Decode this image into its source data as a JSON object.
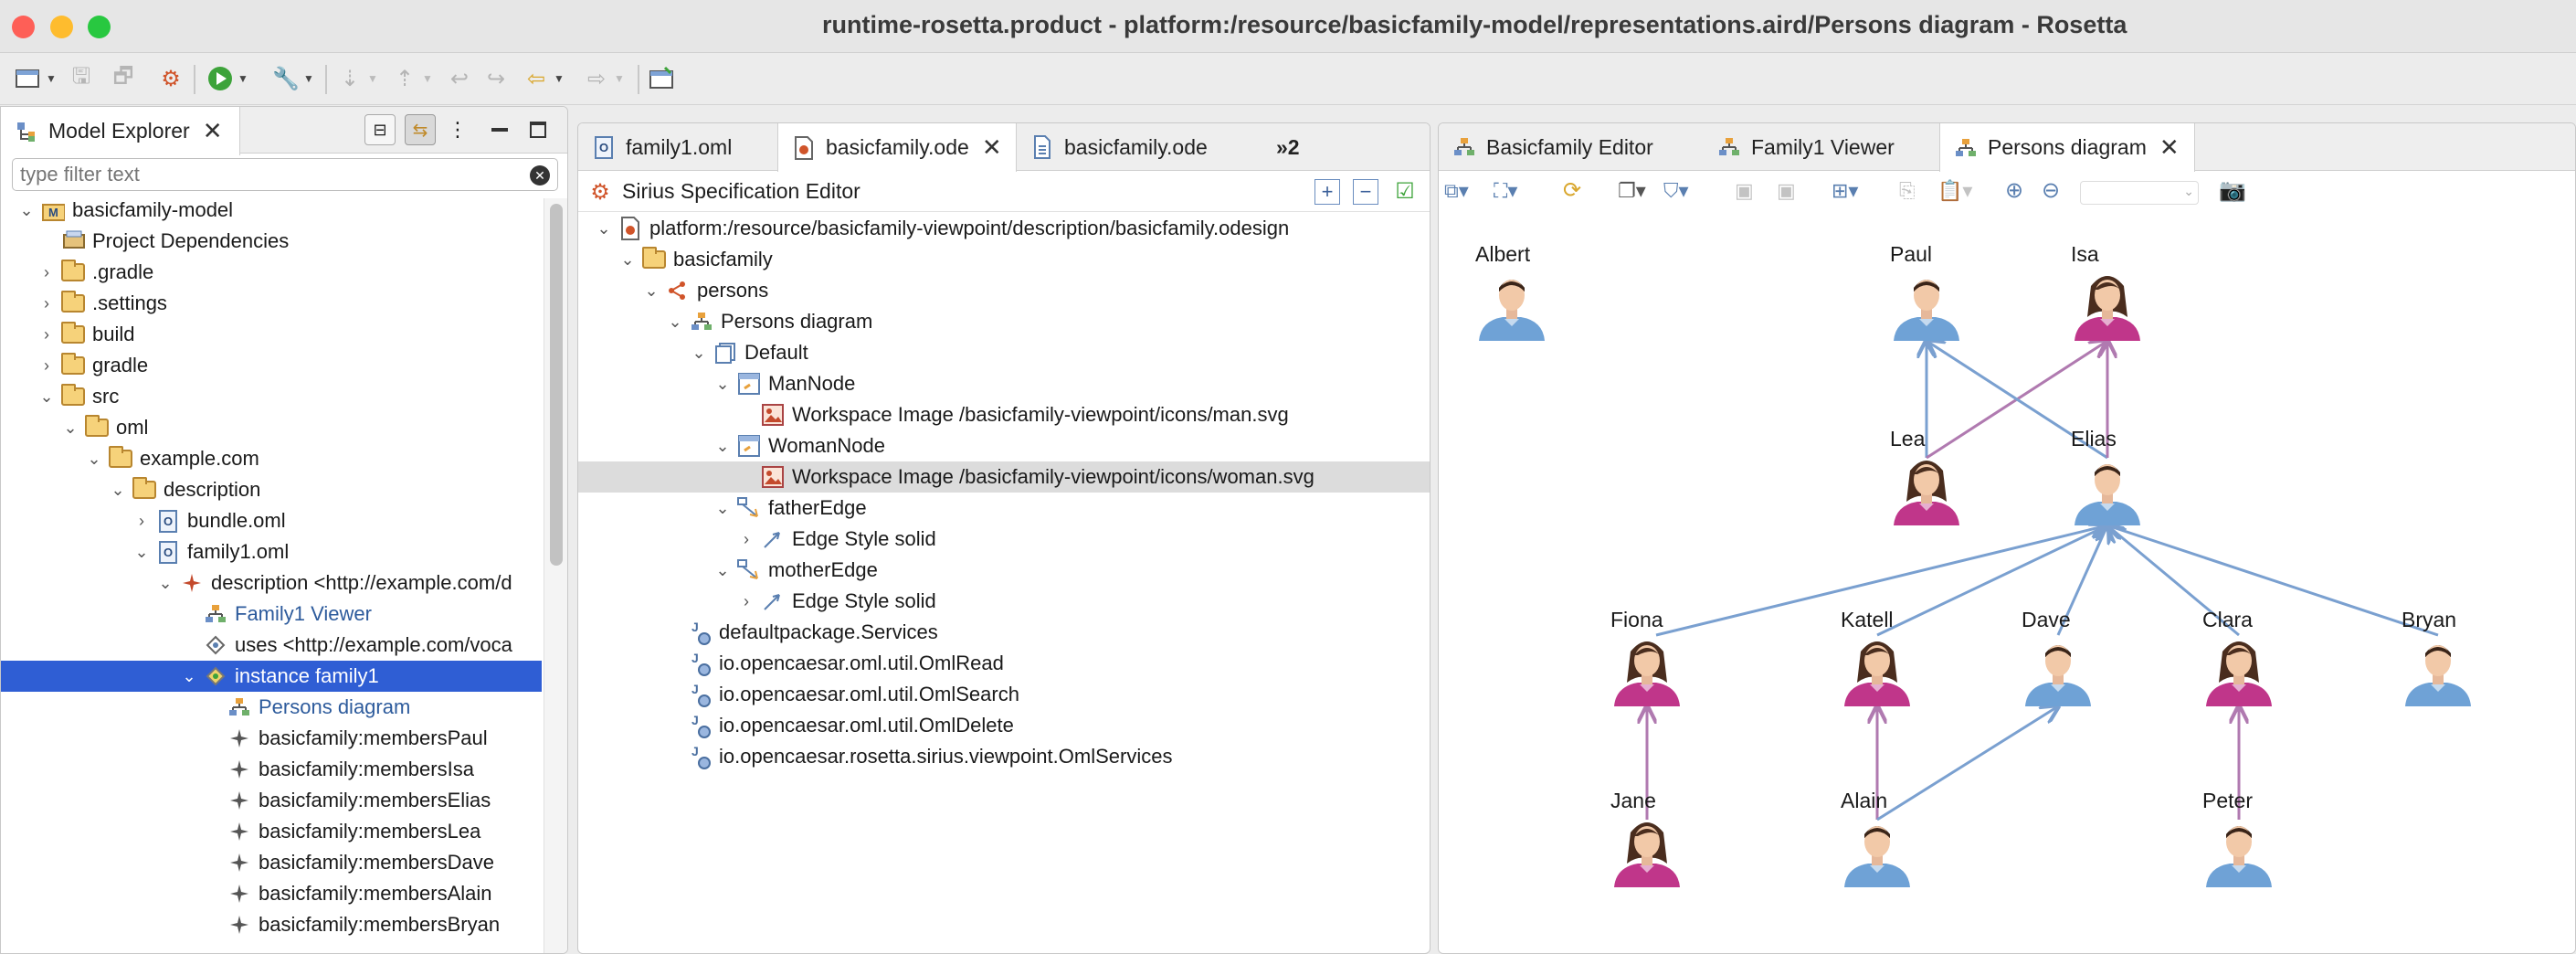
{
  "window": {
    "title": "runtime-rosetta.product - platform:/resource/basicfamily-model/representations.aird/Persons diagram - Rosetta"
  },
  "colors": {
    "selection": "#2f5ed4",
    "father_edge": "#7aa0d0",
    "mother_edge": "#b07ab0",
    "man_shirt": "#6fa2d6",
    "woman_shirt": "#c0368a"
  },
  "model_explorer": {
    "tab_label": "Model Explorer",
    "filter_placeholder": "type filter text",
    "tree": [
      {
        "label": "basicfamily-model",
        "icon": "project-icon",
        "expanded": true
      },
      {
        "label": "Project Dependencies",
        "icon": "library-icon"
      },
      {
        "label": ".gradle",
        "icon": "folder-icon"
      },
      {
        "label": ".settings",
        "icon": "folder-icon"
      },
      {
        "label": "build",
        "icon": "folder-icon"
      },
      {
        "label": "gradle",
        "icon": "folder-icon"
      },
      {
        "label": "src",
        "icon": "folder-icon",
        "expanded": true
      },
      {
        "label": "oml",
        "icon": "folder-icon",
        "expanded": true
      },
      {
        "label": "example.com",
        "icon": "folder-icon",
        "expanded": true
      },
      {
        "label": "description",
        "icon": "folder-icon",
        "expanded": true
      },
      {
        "label": "bundle.oml",
        "icon": "oml-file-icon"
      },
      {
        "label": "family1.oml",
        "icon": "oml-file-icon",
        "expanded": true
      },
      {
        "label": "description <http://example.com/d",
        "icon": "description-icon",
        "expanded": true
      },
      {
        "label": "Family1 Viewer",
        "icon": "diagram-icon",
        "link": true
      },
      {
        "label": "uses <http://example.com/voca",
        "icon": "uses-icon"
      },
      {
        "label": "instance family1",
        "icon": "instance-icon",
        "expanded": true,
        "selected": true
      },
      {
        "label": "Persons diagram",
        "icon": "diagram-icon",
        "link": true
      },
      {
        "label": "basicfamily:membersPaul",
        "icon": "member-icon"
      },
      {
        "label": "basicfamily:membersIsa",
        "icon": "member-icon"
      },
      {
        "label": "basicfamily:membersElias",
        "icon": "member-icon"
      },
      {
        "label": "basicfamily:membersLea",
        "icon": "member-icon"
      },
      {
        "label": "basicfamily:membersDave",
        "icon": "member-icon"
      },
      {
        "label": "basicfamily:membersAlain",
        "icon": "member-icon"
      },
      {
        "label": "basicfamily:membersBryan",
        "icon": "member-icon"
      }
    ]
  },
  "editor": {
    "tabs": [
      {
        "label": "family1.oml",
        "icon": "oml-file-icon"
      },
      {
        "label": "basicfamily.ode",
        "icon": "odesign-icon",
        "active": true,
        "closable": true
      },
      {
        "label": "basicfamily.ode",
        "icon": "file-icon"
      },
      {
        "label": "»2",
        "icon": ""
      }
    ],
    "header": "Sirius Specification Editor",
    "tree": [
      {
        "label": "platform:/resource/basicfamily-viewpoint/description/basicfamily.odesign",
        "icon": "odesign-icon"
      },
      {
        "label": "basicfamily",
        "icon": "folder-icon"
      },
      {
        "label": "persons",
        "icon": "viewpoint-icon"
      },
      {
        "label": "Persons diagram",
        "icon": "diagram-icon"
      },
      {
        "label": "Default",
        "icon": "layer-icon"
      },
      {
        "label": "ManNode",
        "icon": "node-icon"
      },
      {
        "label": "Workspace Image /basicfamily-viewpoint/icons/man.svg",
        "icon": "image-icon"
      },
      {
        "label": "WomanNode",
        "icon": "node-icon"
      },
      {
        "label": "Workspace Image /basicfamily-viewpoint/icons/woman.svg",
        "icon": "image-icon",
        "highlighted": true
      },
      {
        "label": "fatherEdge",
        "icon": "edge-icon"
      },
      {
        "label": "Edge Style solid",
        "icon": "edge-style-icon"
      },
      {
        "label": "motherEdge",
        "icon": "edge-icon"
      },
      {
        "label": "Edge Style solid",
        "icon": "edge-style-icon"
      },
      {
        "label": "defaultpackage.Services",
        "icon": "java-icon"
      },
      {
        "label": "io.opencaesar.oml.util.OmlRead",
        "icon": "java-icon"
      },
      {
        "label": "io.opencaesar.oml.util.OmlSearch",
        "icon": "java-icon"
      },
      {
        "label": "io.opencaesar.oml.util.OmlDelete",
        "icon": "java-icon"
      },
      {
        "label": "io.opencaesar.rosetta.sirius.viewpoint.OmlServices",
        "icon": "java-icon"
      }
    ]
  },
  "diagram": {
    "tabs": [
      {
        "label": "Basicfamily Editor",
        "icon": "diagram-icon"
      },
      {
        "label": "Family1 Viewer",
        "icon": "diagram-icon"
      },
      {
        "label": "Persons diagram",
        "icon": "diagram-icon",
        "active": true,
        "closable": true
      }
    ],
    "persons": [
      {
        "name": "Albert",
        "gender": "man"
      },
      {
        "name": "Paul",
        "gender": "man"
      },
      {
        "name": "Isa",
        "gender": "woman"
      },
      {
        "name": "Lea",
        "gender": "woman"
      },
      {
        "name": "Elias",
        "gender": "man"
      },
      {
        "name": "Fiona",
        "gender": "woman"
      },
      {
        "name": "Katell",
        "gender": "woman"
      },
      {
        "name": "Dave",
        "gender": "man"
      },
      {
        "name": "Clara",
        "gender": "woman"
      },
      {
        "name": "Bryan",
        "gender": "man"
      },
      {
        "name": "Jane",
        "gender": "woman"
      },
      {
        "name": "Alain",
        "gender": "man"
      },
      {
        "name": "Peter",
        "gender": "man"
      }
    ],
    "edges": [
      {
        "from": "Lea",
        "to": "Paul",
        "kind": "father"
      },
      {
        "from": "Lea",
        "to": "Isa",
        "kind": "mother"
      },
      {
        "from": "Elias",
        "to": "Paul",
        "kind": "father"
      },
      {
        "from": "Elias",
        "to": "Isa",
        "kind": "mother"
      },
      {
        "from": "Fiona",
        "to": "Elias",
        "kind": "father"
      },
      {
        "from": "Katell",
        "to": "Elias",
        "kind": "father"
      },
      {
        "from": "Dave",
        "to": "Elias",
        "kind": "father"
      },
      {
        "from": "Clara",
        "to": "Elias",
        "kind": "father"
      },
      {
        "from": "Bryan",
        "to": "Elias",
        "kind": "father"
      },
      {
        "from": "Jane",
        "to": "Fiona",
        "kind": "mother"
      },
      {
        "from": "Alain",
        "to": "Katell",
        "kind": "mother"
      },
      {
        "from": "Alain",
        "to": "Dave",
        "kind": "father"
      },
      {
        "from": "Peter",
        "to": "Clara",
        "kind": "mother"
      }
    ]
  }
}
